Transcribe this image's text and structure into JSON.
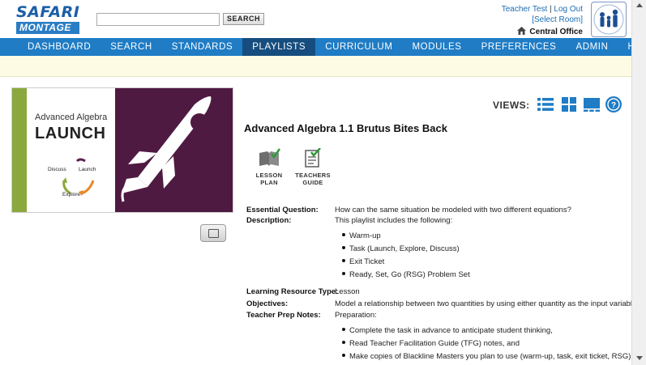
{
  "header": {
    "logo_top": "SAFARI",
    "logo_bottom": "MONTAGE",
    "search_placeholder": "",
    "search_button": "SEARCH",
    "user_name": "Teacher Test",
    "logout": "Log Out",
    "separator": "|",
    "select_room": "[Select Room]",
    "office": "Central Office"
  },
  "nav": {
    "items": [
      "DASHBOARD",
      "SEARCH",
      "STANDARDS",
      "PLAYLISTS",
      "CURRICULUM",
      "MODULES",
      "PREFERENCES",
      "ADMIN",
      "HELP"
    ],
    "active_index": 3
  },
  "thumbnail": {
    "line1": "Advanced Algebra",
    "line2": "LAUNCH",
    "cycle": [
      "Discuss",
      "Launch",
      "Explore"
    ],
    "colors": {
      "green": "#8ba83e",
      "purple": "#4f1a42"
    }
  },
  "views": {
    "label": "VIEWS:",
    "icons": [
      "list-view-icon",
      "grid-view-icon",
      "presentation-view-icon",
      "help-icon"
    ],
    "help_glyph": "?"
  },
  "playlist": {
    "title": "Advanced Algebra 1.1 Brutus Bites Back",
    "resources": [
      {
        "label_line1": "LESSON",
        "label_line2": "PLAN",
        "icon": "lesson-plan-icon"
      },
      {
        "label_line1": "TEACHERS",
        "label_line2": "GUIDE",
        "icon": "teachers-guide-icon"
      }
    ]
  },
  "details": {
    "essential_question_label": "Essential Question:",
    "essential_question": "How can the same situation be modeled with two different equations?",
    "description_label": "Description:",
    "description": "This playlist includes the following:",
    "description_items": [
      "Warm-up",
      "Task (Launch, Explore, Discuss)",
      "Exit Ticket",
      "Ready, Set, Go (RSG) Problem Set"
    ],
    "resource_type_label": "Learning Resource Type:",
    "resource_type": "Lesson",
    "objectives_label": "Objectives:",
    "objectives": "Model a relationship between two quantities by using either quantity as the input variable.",
    "prep_label": "Teacher Prep Notes:",
    "prep": "Preparation:",
    "prep_items": [
      "Complete the task in advance to anticipate student thinking,",
      "Read Teacher Facilitation Guide (TFG) notes, and",
      "Make copies of Blackline Masters you plan to use (warm-up, task, exit ticket, RSG)."
    ]
  },
  "colors": {
    "nav_bg": "#1f7cc5",
    "nav_active": "#164d7e",
    "banner_bg": "#fefbe5",
    "link": "#1a6db5",
    "icon_blue": "#1f7cc5"
  }
}
